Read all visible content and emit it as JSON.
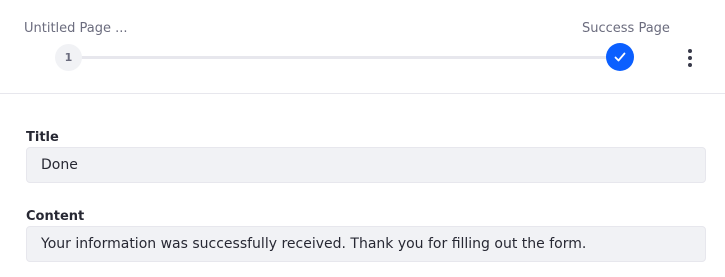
{
  "stepper": {
    "steps": [
      {
        "label": "Untitled Page ...",
        "number": "1",
        "state": "inactive"
      },
      {
        "label": "Success Page",
        "state": "completed",
        "icon": "check-icon"
      }
    ],
    "menu_icon": "kebab-menu-icon",
    "accent_color": "#0b5fff"
  },
  "form": {
    "title": {
      "label": "Title",
      "value": "Done"
    },
    "content": {
      "label": "Content",
      "value": "Your information was successfully received. Thank you for filling out the form."
    }
  }
}
